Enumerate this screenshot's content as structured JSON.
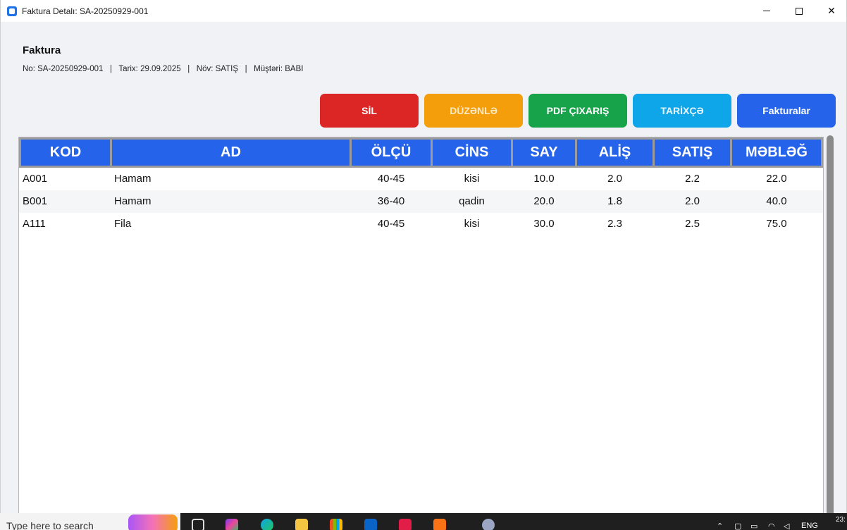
{
  "window": {
    "title": "Faktura Detalı: SA-20250929-001",
    "controls": {
      "minimize": "minimize-icon",
      "maximize": "maximize-icon",
      "close": "✕"
    }
  },
  "header": {
    "title": "Faktura",
    "meta": "No: SA-20250929-001   |   Tarix: 29.09.2025   |   Növ: SATIŞ   |   Müştəri: BABI"
  },
  "actions": {
    "delete": "SİL",
    "edit": "DÜZƏNLƏ",
    "pdf": "PDF ÇIXARIŞ",
    "history": "TARİXÇƏ",
    "invoices": "Fakturalar"
  },
  "colors": {
    "delete": "#dc2626",
    "edit": "#f59e0b",
    "pdf": "#16a34a",
    "history": "#0ea5e9",
    "invoices": "#2563eb",
    "table_header": "#2563eb"
  },
  "table": {
    "columns": [
      "KOD",
      "AD",
      "ÖLÇÜ",
      "CİNS",
      "SAY",
      "ALİŞ",
      "SATIŞ",
      "MƏBLƏĞ"
    ],
    "rows": [
      [
        "A001",
        "Hamam",
        "40-45",
        "kisi",
        "10.0",
        "2.0",
        "2.2",
        "22.0"
      ],
      [
        "B001",
        "Hamam",
        "36-40",
        "qadin",
        "20.0",
        "1.8",
        "2.0",
        "40.0"
      ],
      [
        "A111",
        "Fila",
        "40-45",
        "kisi",
        "30.0",
        "2.3",
        "2.5",
        "75.0"
      ]
    ]
  },
  "taskbar": {
    "search_placeholder": "Type here to search",
    "language": "ENG",
    "clock": "23:"
  }
}
